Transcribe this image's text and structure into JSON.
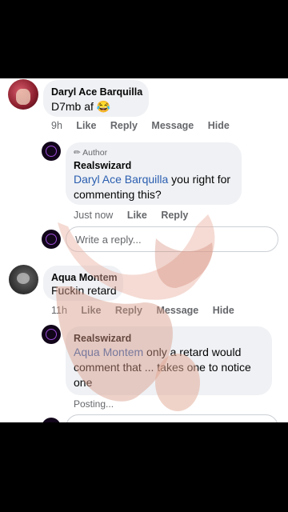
{
  "comments": [
    {
      "author": "Daryl Ace Barquilla",
      "text": "D7mb af",
      "emoji": "😂",
      "time": "9h",
      "actions": [
        "Like",
        "Reply",
        "Message",
        "Hide"
      ]
    },
    {
      "badge": "Author",
      "author": "Realswizard",
      "mention": "Daryl Ace Barquilla",
      "text": " you right for commenting this?",
      "time": "Just now",
      "actions": [
        "Like",
        "Reply"
      ]
    },
    {
      "author": "Aqua Montem",
      "text": "Fuckin retard",
      "time": "11h",
      "actions": [
        "Like",
        "Reply",
        "Message",
        "Hide"
      ]
    },
    {
      "author": "Realswizard",
      "mention": "Aqua Montem",
      "text": " only a retard would comment that ... takes one to notice one",
      "status": "Posting..."
    }
  ],
  "reply_box": {
    "placeholder": "Write a reply..."
  }
}
